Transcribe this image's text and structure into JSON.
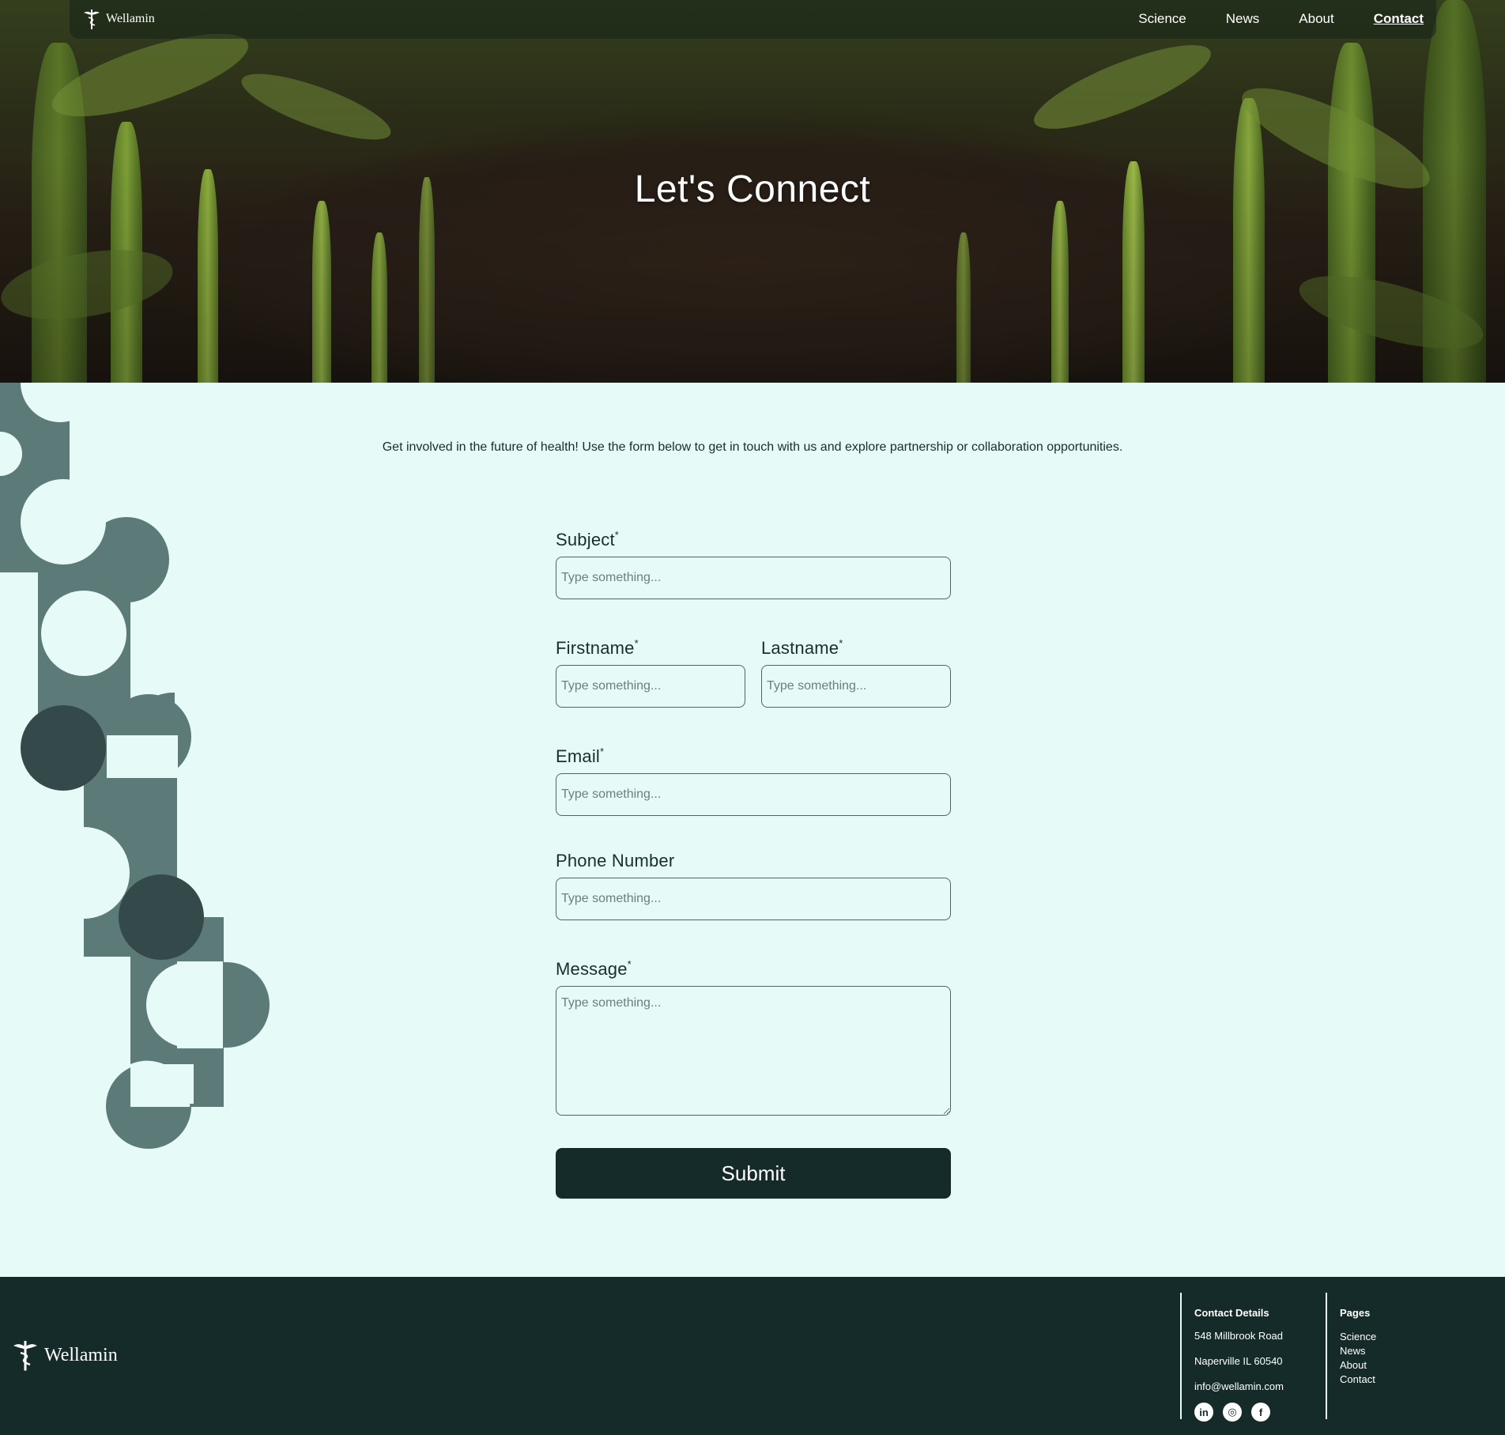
{
  "nav": {
    "brand": "Wellamin",
    "links": [
      {
        "label": "Science"
      },
      {
        "label": "News"
      },
      {
        "label": "About"
      },
      {
        "label": "Contact"
      }
    ]
  },
  "hero": {
    "title": "Let's Connect"
  },
  "intro": "Get involved in the future of health! Use the form below to get in touch with us and explore partnership or collaboration opportunities.",
  "form": {
    "subject": {
      "label": "Subject",
      "required": "*",
      "placeholder": "Type something..."
    },
    "firstname": {
      "label": "Firstname",
      "required": "*",
      "placeholder": "Type something..."
    },
    "lastname": {
      "label": "Lastname",
      "required": "*",
      "placeholder": "Type something..."
    },
    "email": {
      "label": "Email",
      "required": "*",
      "placeholder": "Type something..."
    },
    "phone": {
      "label": "Phone Number",
      "placeholder": "Type something..."
    },
    "message": {
      "label": "Message",
      "required": "*",
      "placeholder": "Type something..."
    },
    "submit": "Submit"
  },
  "footer": {
    "brand": "Wellamin",
    "contact": {
      "title": "Contact Details",
      "address1": "548 Millbrook Road",
      "address2": "Naperville IL 60540",
      "email": "info@wellamin.com"
    },
    "pages": {
      "title": "Pages",
      "items": [
        "Science",
        "News",
        "About",
        "Contact"
      ]
    },
    "socials": [
      {
        "icon": "linkedin-icon",
        "glyph": "in"
      },
      {
        "icon": "instagram-icon",
        "glyph": "◎"
      },
      {
        "icon": "facebook-icon",
        "glyph": "f"
      }
    ]
  },
  "colors": {
    "background": "#e6faf8",
    "dark": "#152b29",
    "deco": "#5c7b78",
    "deco_dark": "#33494a"
  }
}
